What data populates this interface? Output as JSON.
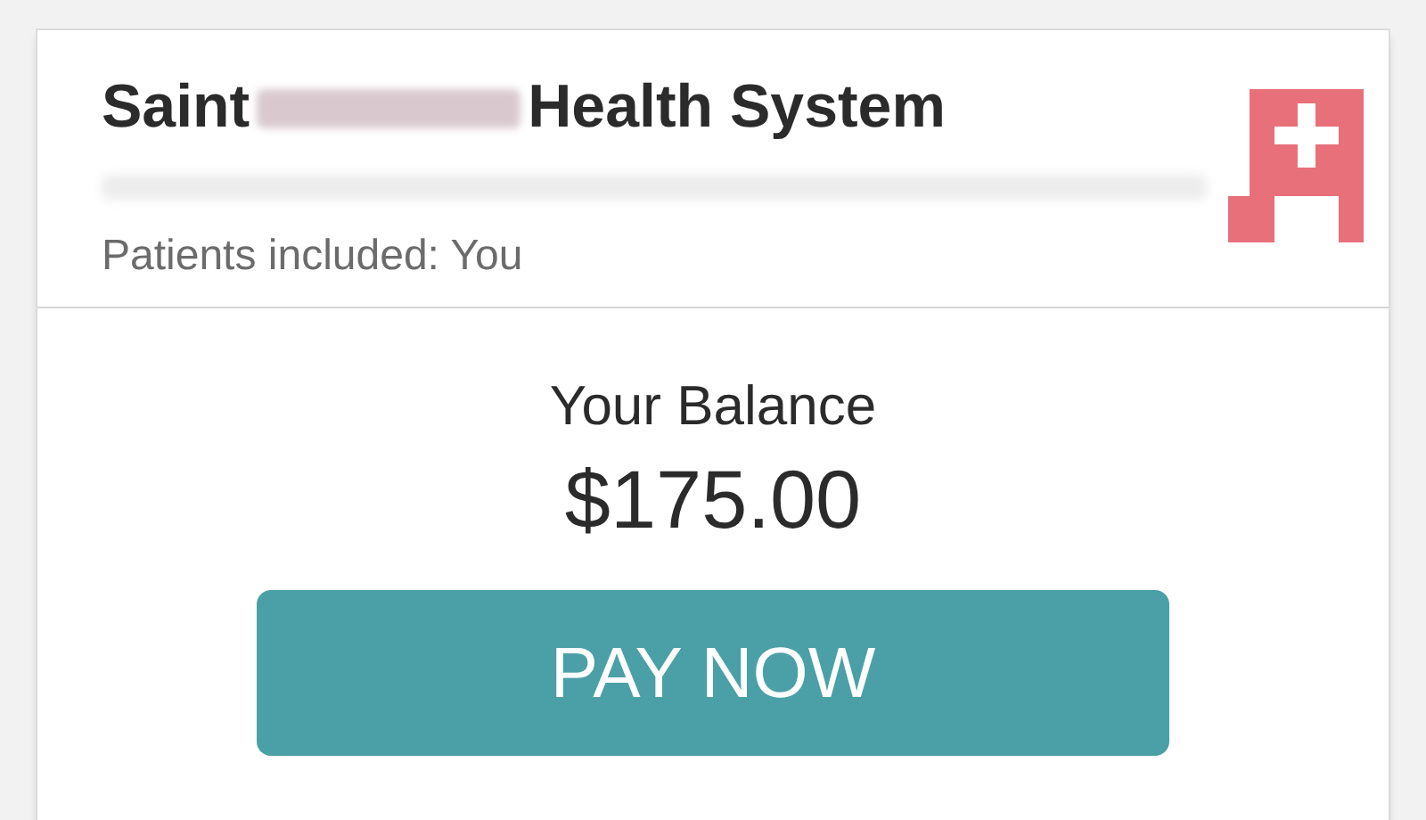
{
  "provider": {
    "name_start": "Saint",
    "name_end": "Health System",
    "patients_label": "Patients included: You"
  },
  "balance": {
    "label": "Your Balance",
    "amount": "$175.00"
  },
  "pay_button": {
    "label": "PAY NOW"
  }
}
